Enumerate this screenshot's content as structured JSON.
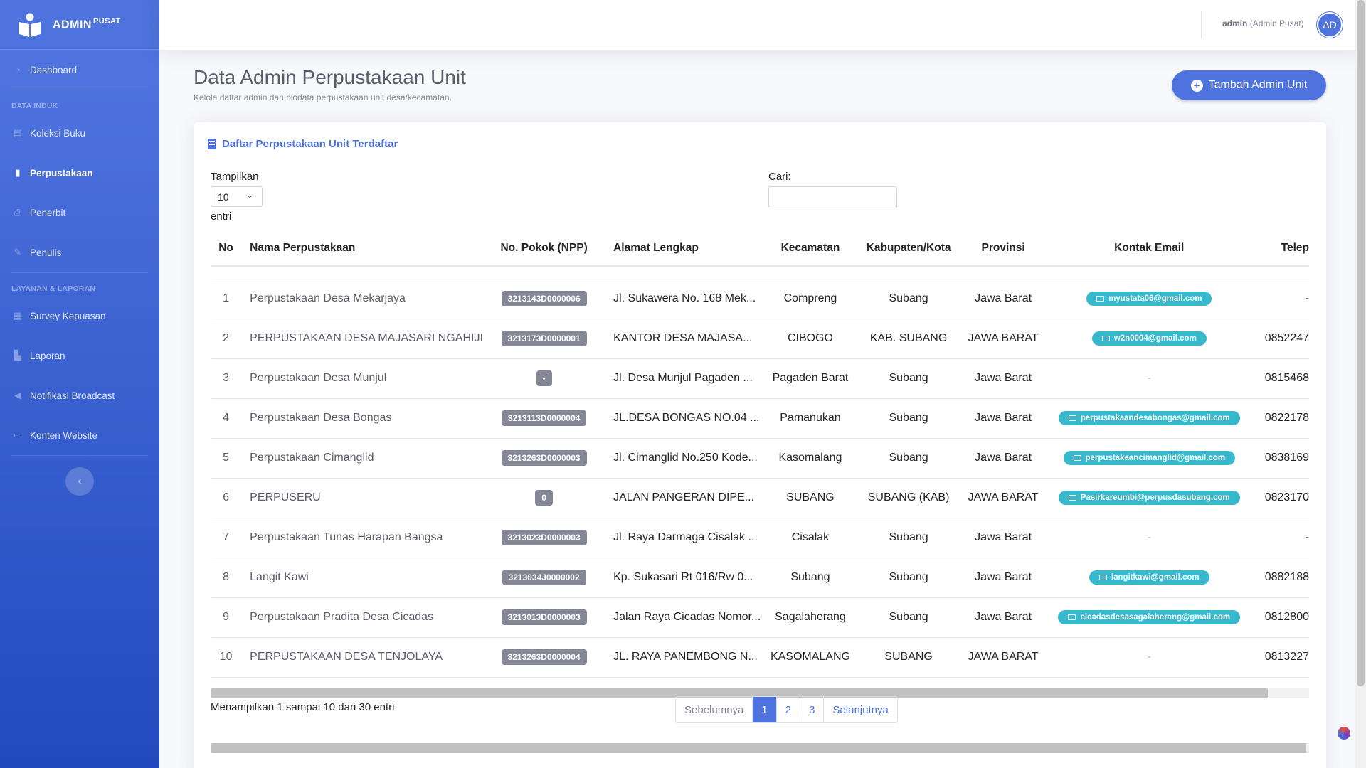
{
  "brand": {
    "title": "ADMIN",
    "suffix": "PUSAT"
  },
  "sidebar": {
    "items": [
      {
        "label": "Dashboard"
      },
      {
        "heading": "DATA INDUK"
      },
      {
        "label": "Koleksi Buku"
      },
      {
        "label": "Perpustakaan",
        "active": true
      },
      {
        "label": "Penerbit"
      },
      {
        "label": "Penulis"
      },
      {
        "heading": "LAYANAN & LAPORAN"
      },
      {
        "label": "Survey Kepuasan"
      },
      {
        "label": "Laporan"
      },
      {
        "label": "Notifikasi Broadcast"
      },
      {
        "label": "Konten Website"
      }
    ]
  },
  "topbar": {
    "user_name": "admin",
    "user_role": "(Admin Pusat)",
    "avatar_initials": "AD"
  },
  "page": {
    "title": "Data Admin Perpustakaan Unit",
    "subtitle": "Kelola daftar admin dan biodata perpustakaan unit desa/kecamatan.",
    "add_button": "Tambah Admin Unit"
  },
  "card": {
    "title": "Daftar Perpustakaan Unit Terdaftar",
    "length_label": "Tampilkan",
    "length_value": "10",
    "length_suffix": "entri",
    "search_label": "Cari:",
    "search_value": ""
  },
  "table": {
    "headers": [
      "No",
      "Nama Perpustakaan",
      "No. Pokok (NPP)",
      "Alamat Lengkap",
      "Kecamatan",
      "Kabupaten/Kota",
      "Provinsi",
      "Kontak Email",
      "Telep"
    ],
    "rows": [
      [
        "1",
        "Perpustakaan Desa Mekarjaya",
        "3213143D0000006",
        "Jl. Sukawera No. 168 Mek...",
        "Compreng",
        "Subang",
        "Jawa Barat",
        "myustata06@gmail.com",
        "-"
      ],
      [
        "2",
        "PERPUSTAKAAN DESA MAJASARI NGAHIJI",
        "3213173D0000001",
        "KANTOR DESA MAJASA...",
        "CIBOGO",
        "KAB. SUBANG",
        "JAWA BARAT",
        "w2n0004@gmail.com",
        "0852247"
      ],
      [
        "3",
        "Perpustakaan Desa Munjul",
        "-",
        "Jl. Desa Munjul Pagaden ...",
        "Pagaden Barat",
        "Subang",
        "Jawa Barat",
        "-",
        "0815468"
      ],
      [
        "4",
        "Perpustakaan Desa Bongas",
        "3213113D0000004",
        "JL.DESA BONGAS NO.04 ...",
        "Pamanukan",
        "Subang",
        "Jawa Barat",
        "perpustakaandesabongas@gmail.com",
        "0822178"
      ],
      [
        "5",
        "Perpustakaan Cimanglid",
        "3213263D0000003",
        "Jl. Cimanglid No.250 Kode...",
        "Kasomalang",
        "Subang",
        "Jawa Barat",
        "perpustakaancimanglid@gmail.com",
        "0838169"
      ],
      [
        "6",
        "PERPUSERU",
        "0",
        "JALAN PANGERAN DIPE...",
        "SUBANG",
        "SUBANG (KAB)",
        "JAWA BARAT",
        "Pasirkareumbi@perpusdasubang.com",
        "0823170"
      ],
      [
        "7",
        "Perpustakaan Tunas Harapan Bangsa",
        "3213023D0000003",
        "Jl. Raya Darmaga Cisalak ...",
        "Cisalak",
        "Subang",
        "Jawa Barat",
        "-",
        "-"
      ],
      [
        "8",
        "Langit Kawi",
        "3213034J0000002",
        "Kp. Sukasari Rt 016/Rw 0...",
        "Subang",
        "Subang",
        "Jawa Barat",
        "langitkawi@gmail.com",
        "0882188"
      ],
      [
        "9",
        "Perpustakaan Pradita Desa Cicadas",
        "3213013D0000003",
        "Jalan Raya Cicadas Nomor...",
        "Sagalaherang",
        "Subang",
        "Jawa Barat",
        "cicadasdesasagalaherang@gmail.com",
        "0812800"
      ],
      [
        "10",
        "PERPUSTAKAAN DESA TENJOLAYA",
        "3213263D0000004",
        "JL. RAYA PANEMBONG N...",
        "KASOMALANG",
        "SUBANG",
        "JAWA BARAT",
        "-",
        "0813227"
      ]
    ]
  },
  "footer": {
    "info": "Menampilkan 1 sampai 10 dari 30 entri",
    "prev": "Sebelumnya",
    "pages": [
      "1",
      "2",
      "3"
    ],
    "current_page": "1",
    "next": "Selanjutnya"
  },
  "colors": {
    "primary": "#4e73df",
    "info": "#36b9cc",
    "secondary": "#858796"
  }
}
